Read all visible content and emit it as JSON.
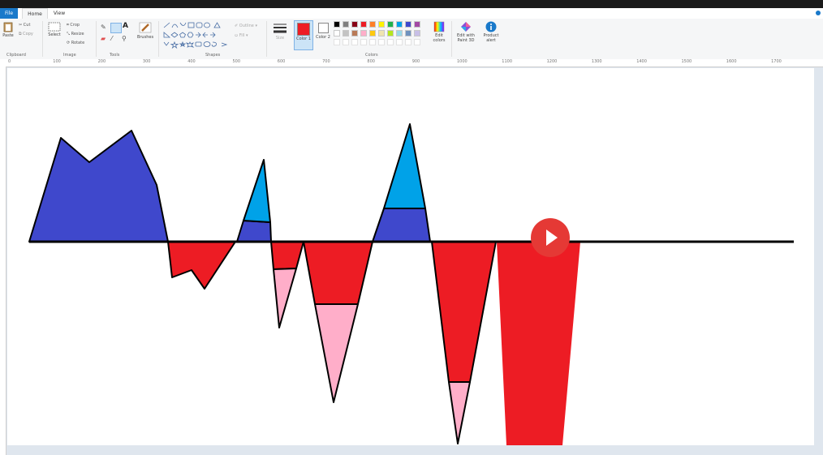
{
  "tabs": {
    "file": "File",
    "home": "Home",
    "view": "View"
  },
  "clipboard": {
    "paste": "Paste",
    "cut": "Cut",
    "copy": "Copy",
    "label": "Clipboard"
  },
  "image": {
    "select": "Select",
    "crop": "Crop",
    "resize": "Resize",
    "rotate": "Rotate",
    "label": "Image"
  },
  "tools": {
    "label": "Tools"
  },
  "brushes": {
    "label": "Brushes"
  },
  "shapes": {
    "label": "Shapes",
    "outline": "Outline",
    "fill": "Fill"
  },
  "size": {
    "label": "Size"
  },
  "colors": {
    "color1": "Color 1",
    "color2": "Color 2",
    "edit": "Edit colors",
    "label": "Colors",
    "active_color1": "#ed1c24",
    "active_color2": "#ffffff",
    "palette_row1": [
      "#000000",
      "#7f7f7f",
      "#880015",
      "#ed1c24",
      "#ff7f27",
      "#fff200",
      "#22b14c",
      "#00a2e8",
      "#3f48cc",
      "#a349a4"
    ],
    "palette_row2": [
      "#ffffff",
      "#c3c3c3",
      "#b97a57",
      "#ffaec9",
      "#ffc90e",
      "#efe4b0",
      "#b5e61d",
      "#99d9ea",
      "#7092be",
      "#c8bfe7"
    ]
  },
  "paint3d": {
    "label": "Edit with Paint 3D"
  },
  "product_alert": {
    "label": "Product alert"
  },
  "ruler": {
    "ticks": [
      "0",
      "100",
      "200",
      "300",
      "400",
      "500",
      "600",
      "700",
      "800",
      "900",
      "1000",
      "1100",
      "1200",
      "1300",
      "1400",
      "1500",
      "1600",
      "1700"
    ]
  },
  "drawing": {
    "fill_blue": "#3f48cc",
    "fill_cyan": "#00a2e8",
    "fill_red": "#ed1c24",
    "fill_pink": "#ffaec9",
    "outline": "#000000"
  },
  "video": {
    "play_color": "#e53935"
  }
}
